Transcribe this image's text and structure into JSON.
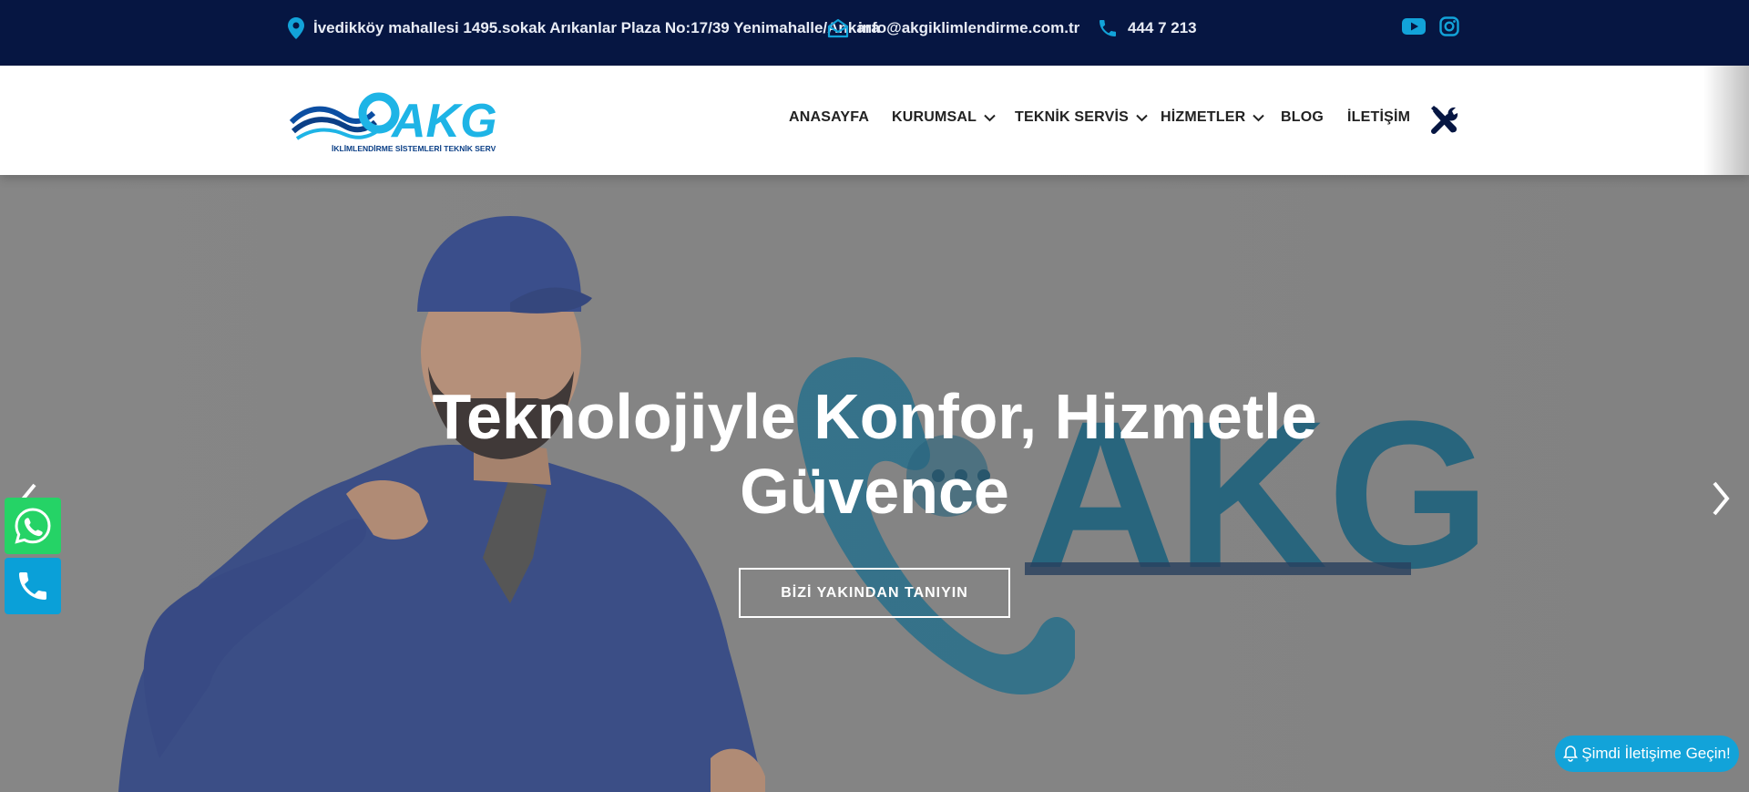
{
  "topbar": {
    "address": "İvedikköy mahallesi 1495.sokak Arıkanlar Plaza No:17/39 Yenimahalle/Ankara",
    "email": "info@akgiklimlendirme.com.tr",
    "phone": "444 7 213",
    "icons": {
      "address": "map-pin-icon",
      "email": "envelope-icon",
      "phone": "phone-icon",
      "youtube": "youtube-icon",
      "instagram": "instagram-icon"
    }
  },
  "header": {
    "logo": {
      "text": "AKG",
      "tagline": "İKLİMLENDİRME SİSTEMLERİ TEKNİK SERVİSİ"
    },
    "nav": [
      {
        "label": "ANASAYFA",
        "has_dropdown": false
      },
      {
        "label": "KURUMSAL",
        "has_dropdown": true
      },
      {
        "label": "TEKNİK SERVİS",
        "has_dropdown": true
      },
      {
        "label": "HİZMETLER",
        "has_dropdown": true
      },
      {
        "label": "BLOG",
        "has_dropdown": false
      },
      {
        "label": "İLETİŞİM",
        "has_dropdown": false
      }
    ],
    "tools_icon": "tools-icon"
  },
  "hero": {
    "title_line1": "Teknolojiyle Konfor, Hizmetle",
    "title_line2": "Güvence",
    "cta": "BİZİ YAKINDAN TANIYIN",
    "bg_logo_text": "AKG"
  },
  "floating": {
    "whatsapp_icon": "whatsapp-icon",
    "call_icon": "phone-icon",
    "contact_pill": "Şimdi İletişime Geçin!"
  },
  "colors": {
    "topbar_bg": "#061642",
    "accent": "#12a3d9",
    "whatsapp": "#25d366",
    "logo_blue": "#0b4ea2",
    "logo_cyan": "#1eb4e6"
  }
}
